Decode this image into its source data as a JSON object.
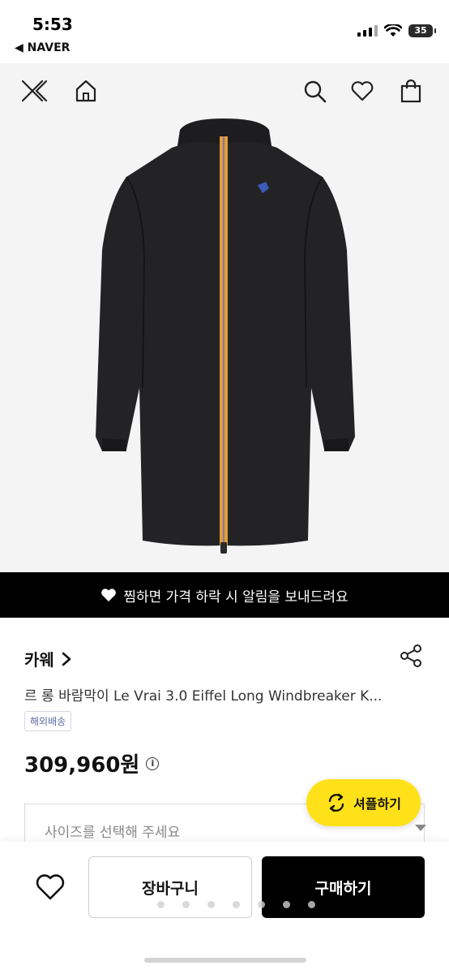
{
  "status_bar": {
    "time": "5:53",
    "back_app": "◀ NAVER",
    "battery": "35"
  },
  "nav": {
    "icons": [
      "close-icon",
      "back-icon",
      "home-icon",
      "search-icon",
      "heart-icon",
      "bag-icon"
    ]
  },
  "alert": {
    "text": "찜하면 가격 하락 시 알림을 보내드려요"
  },
  "product": {
    "brand": "카웨",
    "brand_chevron": "›",
    "title": "르 롱 바람막이 Le Vrai 3.0 Eiffel Long Windbreaker K...",
    "badge": "해외배송",
    "price": "309,960원",
    "info": "i"
  },
  "size_select": {
    "placeholder": "사이즈를 선택해 주세요"
  },
  "shuffle": {
    "label": "셔플하기"
  },
  "bottom_bar": {
    "cart_label": "장바구니",
    "buy_label": "구매하기"
  },
  "colors": {
    "accent_yellow": "#ffe11a",
    "banner_black": "#000000",
    "badge_blue": "#5a6ea6"
  }
}
